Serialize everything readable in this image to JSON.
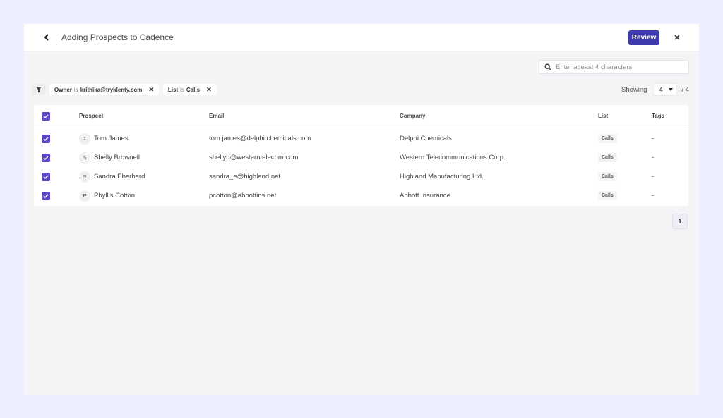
{
  "header": {
    "title": "Adding Prospects to Cadence",
    "review_label": "Review"
  },
  "search": {
    "placeholder": "Enter atleast 4 characters",
    "value": ""
  },
  "filters": [
    {
      "field": "Owner",
      "op": "is",
      "value": "krithika@tryklenty.com"
    },
    {
      "field": "List",
      "op": "is",
      "value": "Calls"
    }
  ],
  "showing": {
    "label": "Showing",
    "selected": "4",
    "total": "/ 4"
  },
  "table": {
    "columns": [
      "Prospect",
      "Email",
      "Company",
      "List",
      "Tags"
    ],
    "rows": [
      {
        "initial": "T",
        "name": "Tom James",
        "email": "tom.james@delphi.chemicals.com",
        "company": "Delphi Chemicals",
        "list": "Calls",
        "tags": "-",
        "checked": true
      },
      {
        "initial": "S",
        "name": "Shelly Brownell",
        "email": "shellyb@westerntelecom.com",
        "company": "Western Telecommunications Corp.",
        "list": "Calls",
        "tags": "-",
        "checked": true
      },
      {
        "initial": "S",
        "name": "Sandra Eberhard",
        "email": "sandra_e@highland.net",
        "company": "Highland Manufacturing Ltd.",
        "list": "Calls",
        "tags": "-",
        "checked": true
      },
      {
        "initial": "P",
        "name": "Phyllis Cotton",
        "email": "pcotton@abbottins.net",
        "company": "Abbott Insurance",
        "list": "Calls",
        "tags": "-",
        "checked": true
      }
    ]
  },
  "pagination": {
    "current_page": "1"
  },
  "colors": {
    "accent": "#3c3aad",
    "checkbox": "#5a48c9",
    "page_bg": "#eeeffe"
  }
}
